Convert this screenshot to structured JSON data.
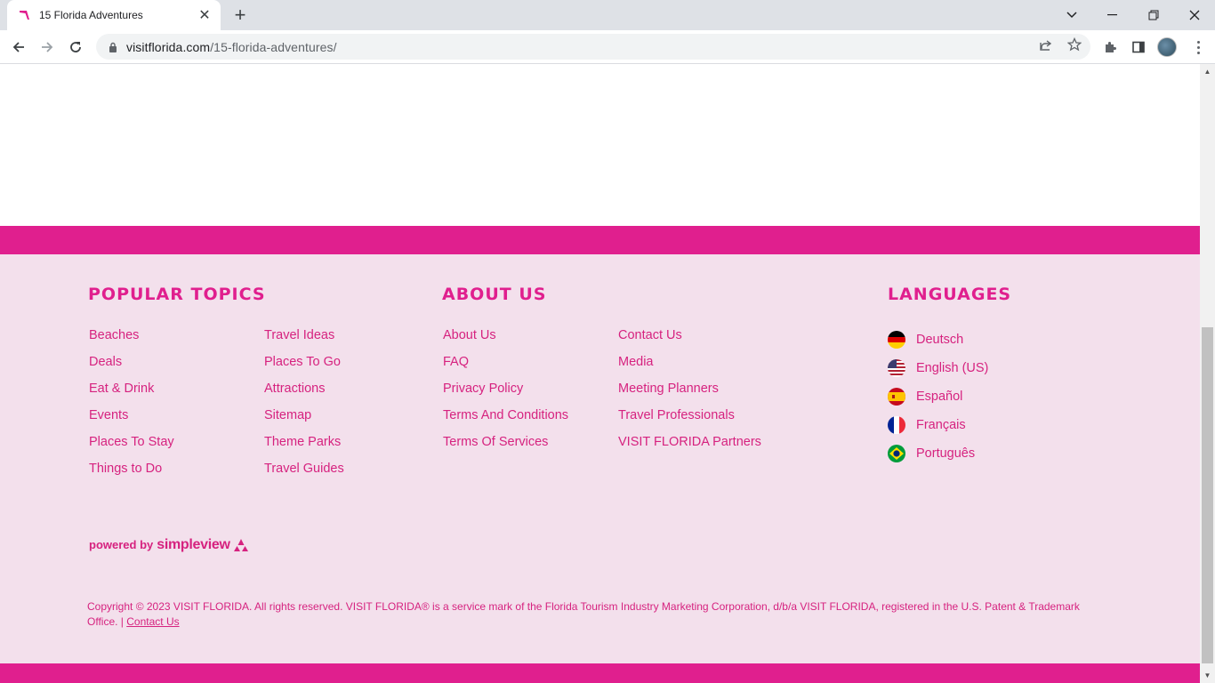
{
  "browser": {
    "tab_title": "15 Florida Adventures",
    "url_host": "visitflorida.com",
    "url_path": "/15-florida-adventures/"
  },
  "footer": {
    "popular_topics": {
      "heading": "POPULAR TOPICS",
      "col1": [
        "Beaches",
        "Deals",
        "Eat & Drink",
        "Events",
        "Places To Stay",
        "Things to Do"
      ],
      "col2": [
        "Travel Ideas",
        "Places To Go",
        "Attractions",
        "Sitemap",
        "Theme Parks",
        "Travel Guides"
      ]
    },
    "about_us": {
      "heading": "ABOUT US",
      "col1": [
        "About Us",
        "FAQ",
        "Privacy Policy",
        "Terms And Conditions",
        "Terms Of Services"
      ],
      "col2": [
        "Contact Us",
        "Media",
        "Meeting Planners",
        "Travel Professionals",
        "VISIT FLORIDA Partners"
      ]
    },
    "languages": {
      "heading": "LANGUAGES",
      "items": [
        {
          "label": "Deutsch",
          "flag": "germany-flag-icon"
        },
        {
          "label": "English (US)",
          "flag": "usa-flag-icon"
        },
        {
          "label": "Español",
          "flag": "spain-flag-icon"
        },
        {
          "label": "Français",
          "flag": "france-flag-icon"
        },
        {
          "label": "Português",
          "flag": "brazil-flag-icon"
        }
      ]
    },
    "powered_by": "powered by",
    "powered_brand": "simpleview",
    "copyright_text": "Copyright © 2023 VISIT FLORIDA. All rights reserved. VISIT FLORIDA® is a service mark of the Florida Tourism Industry Marketing Corporation, d/b/a VISIT FLORIDA, registered in the U.S. Patent & Trademark Office. | ",
    "copyright_link": "Contact Us"
  },
  "colors": {
    "brand_pink": "#e01f8e",
    "footer_bg": "#f3e0ec",
    "link_pink": "#d6227f"
  }
}
